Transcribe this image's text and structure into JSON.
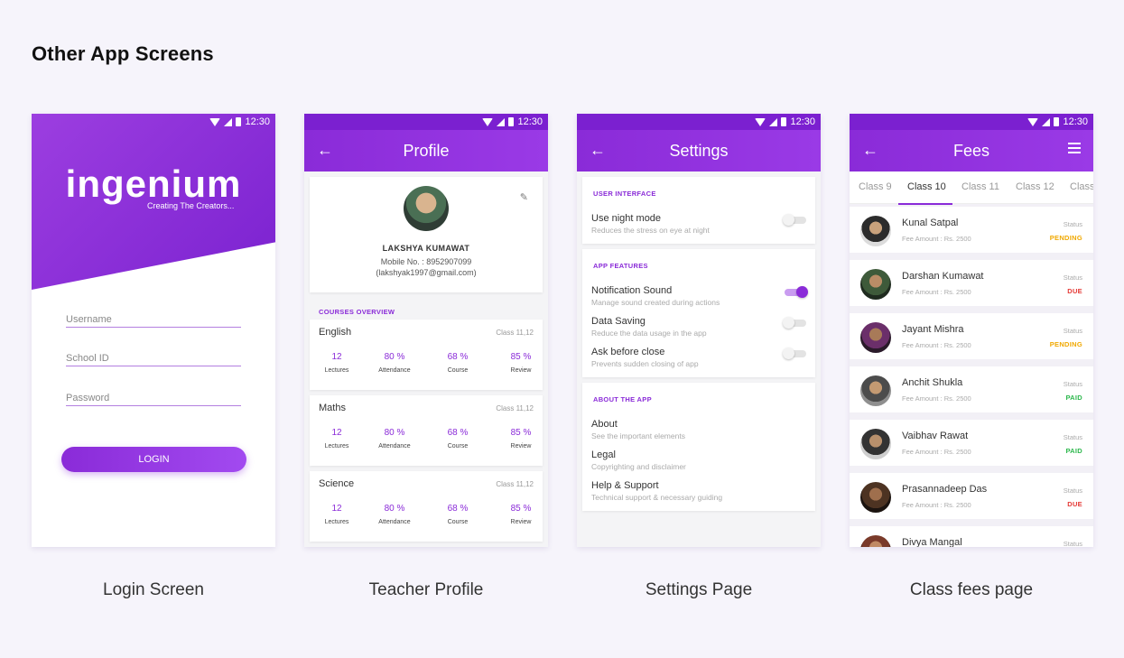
{
  "page_title": "Other App Screens",
  "status_time": "12:30",
  "captions": [
    "Login Screen",
    "Teacher Profile",
    "Settings Page",
    "Class fees page"
  ],
  "login": {
    "logo": "ingenium",
    "tagline": "Creating The Creators...",
    "username_placeholder": "Username",
    "school_id_placeholder": "School ID",
    "password_placeholder": "Password",
    "login_button": "LOGIN"
  },
  "profile": {
    "title": "Profile",
    "name": "LAKSHYA KUMAWAT",
    "mobile": "Mobile No. : 8952907099",
    "email": "(lakshyak1997@gmail.com)",
    "courses_caption": "COURSES OVERVIEW",
    "courses": [
      {
        "name": "English",
        "class": "Class 11,12",
        "lectures": "12",
        "attendance": "80 %",
        "course": "68 %",
        "review": "85 %"
      },
      {
        "name": "Maths",
        "class": "Class 11,12",
        "lectures": "12",
        "attendance": "80 %",
        "course": "68 %",
        "review": "85 %"
      },
      {
        "name": "Science",
        "class": "Class 11,12",
        "lectures": "12",
        "attendance": "80 %",
        "course": "68 %",
        "review": "85 %"
      }
    ],
    "stat_labels": {
      "lectures": "Lectures",
      "attendance": "Attendance",
      "course": "Course",
      "review": "Review"
    }
  },
  "settings": {
    "title": "Settings",
    "sections": [
      {
        "caption": "USER INTERFACE",
        "items": [
          {
            "title": "Use night mode",
            "subtitle": "Reduces the stress on eye at night",
            "on": false
          }
        ]
      },
      {
        "caption": "APP FEATURES",
        "items": [
          {
            "title": "Notification Sound",
            "subtitle": "Manage sound created during actions",
            "on": true
          },
          {
            "title": "Data Saving",
            "subtitle": "Reduce the data usage in the app",
            "on": false
          },
          {
            "title": "Ask before close",
            "subtitle": "Prevents sudden closing of app",
            "on": false
          }
        ]
      },
      {
        "caption": "ABOUT THE APP",
        "items": [
          {
            "title": "About",
            "subtitle": "See the important elements"
          },
          {
            "title": "Legal",
            "subtitle": "Copyrighting and disclaimer"
          },
          {
            "title": "Help & Support",
            "subtitle": "Technical support & necessary guiding"
          }
        ]
      }
    ]
  },
  "fees": {
    "title": "Fees",
    "tabs": [
      "Class 9",
      "Class 10",
      "Class 11",
      "Class 12",
      "Class"
    ],
    "active_tab": "Class 10",
    "status_label": "Status",
    "students": [
      {
        "name": "Kunal Satpal",
        "amount": "Fee Amount : Rs. 2500",
        "status": "PENDING"
      },
      {
        "name": "Darshan Kumawat",
        "amount": "Fee Amount : Rs. 2500",
        "status": "DUE"
      },
      {
        "name": "Jayant Mishra",
        "amount": "Fee Amount : Rs. 2500",
        "status": "PENDING"
      },
      {
        "name": "Anchit Shukla",
        "amount": "Fee Amount : Rs. 2500",
        "status": "PAID"
      },
      {
        "name": "Vaibhav Rawat",
        "amount": "Fee Amount : Rs. 2500",
        "status": "PAID"
      },
      {
        "name": "Prasannadeep Das",
        "amount": "Fee Amount : Rs. 2500",
        "status": "DUE"
      },
      {
        "name": "Divya Mangal",
        "amount": "",
        "status": ""
      }
    ],
    "status_colors": {
      "PENDING": "#f0a800",
      "DUE": "#e53935",
      "PAID": "#2db84d"
    }
  },
  "colors": {
    "accent": "#8a2bd8",
    "background": "#f6f4fb"
  }
}
